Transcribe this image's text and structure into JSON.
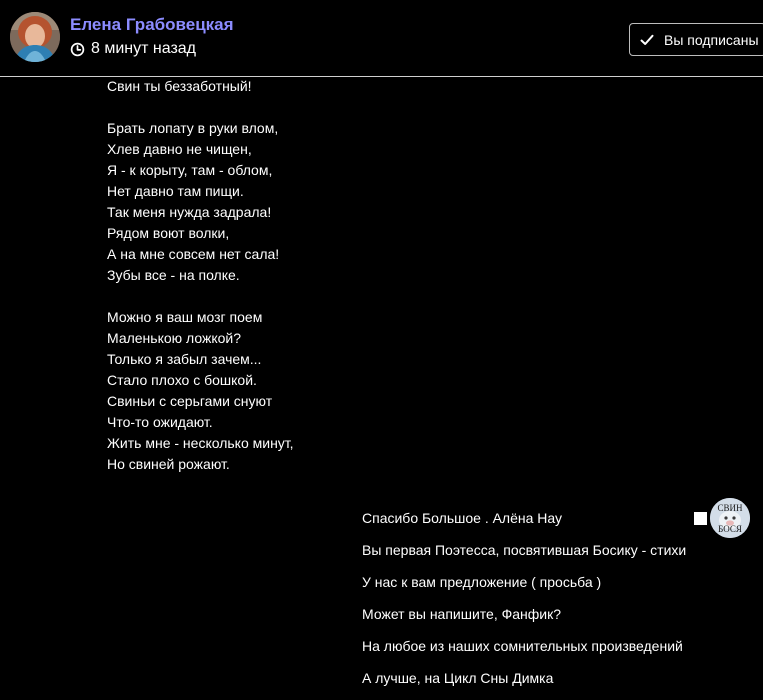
{
  "header": {
    "author_name": "Елена Грабовецкая",
    "time_icon": "clock-icon",
    "time_ago": "8 минут назад",
    "subscribe": {
      "icon": "checkmark-icon",
      "label": "Вы подписаны"
    }
  },
  "poem": {
    "lines": [
      "Свин ты беззаботный!",
      "",
      "Брать лопату в руки влом,",
      "Хлев давно не чищен,",
      "Я - к корыту, там - облом,",
      "Нет давно там пищи.",
      "Так меня нужда задрала!",
      "Рядом воют волки,",
      "А на мне совсем нет сала!",
      "Зубы все - на полке.",
      "",
      "Можно я ваш мозг поем",
      "Маленькою ложкой?",
      "Только я забыл зачем...",
      "Стало плохо с бошкой.",
      "Свиньи с серьгами снуют",
      "Что-то ожидают.",
      "Жить мне - несколько минут,",
      "Но свиней рожают."
    ]
  },
  "reply": {
    "avatar_label_top": "СВИН",
    "avatar_label_bottom": "БОСЯ",
    "lines": [
      "Спасибо Большое . Алёна Нау",
      "Вы первая Поэтесса, посвятившая Босику - стихи",
      "У нас к вам предложение ( просьба )",
      "Может вы напишите, Фанфик?",
      "На любое из наших сомнительных произведений",
      "А лучше, на Цикл Сны Димка"
    ]
  },
  "colors": {
    "background": "#000000",
    "author_name": "#8c8cff",
    "text": "#ffffff",
    "divider": "#cfcfcf"
  }
}
